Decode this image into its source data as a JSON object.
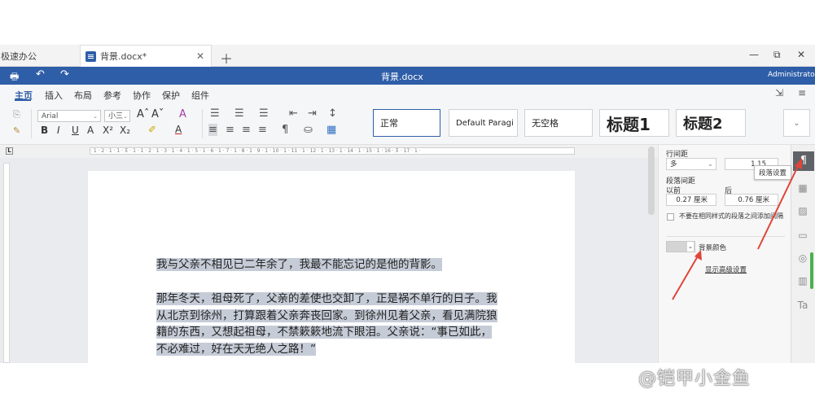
{
  "tabs": [
    {
      "label": "极速办公"
    },
    {
      "label": "背景.docx*"
    }
  ],
  "window": {
    "title": "背景.docx",
    "user": "Administrator"
  },
  "menu": [
    {
      "label": "主页"
    },
    {
      "label": "插入"
    },
    {
      "label": "布局"
    },
    {
      "label": "参考"
    },
    {
      "label": "协作"
    },
    {
      "label": "保护"
    },
    {
      "label": "组件"
    }
  ],
  "toolbar": {
    "font_name": "Arial",
    "font_size": "小三",
    "styles": [
      {
        "label": "正常"
      },
      {
        "label": "Default Paragi"
      },
      {
        "label": "无空格"
      },
      {
        "label": "标题1"
      },
      {
        "label": "标题2"
      }
    ]
  },
  "ruler": {
    "text": "· 1 · 2 · 1 · 1 · ⊼ · 1 · 1 · 2 · 1 · 3 · 1 · 4 · 1 · 5 · 1 · 6 · 1 · 7 · 1 · 8 · 1 · 9 · 1 · 10 · 1 · 11 · 1 · 12 · 1 · 13 · 1 · 14 · 1 · 15 · 1 · 16 · ⊼ · 17 · 1 ·"
  },
  "document": {
    "paragraphs": [
      {
        "lines": [
          "我与父亲不相见已二年余了，我最不能忘记的是他的背影。"
        ]
      },
      {
        "lines": [
          "那年冬天，祖母死了，父亲的差使也交卸了，正是祸不单行的日子。我",
          "从北京到徐州，打算跟着父亲奔丧回家。到徐州见着父亲，看见满院狼",
          "籍的东西，又想起祖母，不禁簌簌地流下眼泪。父亲说：“事已如此，",
          "不必难过，好在天无绝人之路！”"
        ]
      }
    ]
  },
  "panel": {
    "line_spacing_label": "行间距",
    "line_spacing_mode": "多",
    "line_spacing_value": "1.15",
    "para_spacing_label": "段落间距",
    "before_label": "以前",
    "after_label": "后",
    "before_value": "0.27 厘米",
    "after_value": "0.76 厘米",
    "no_space_label": "不要在相同样式的段落之间添加间隔",
    "bg_color_label": "背景颜色",
    "advanced_label": "显示高级设置",
    "tooltip": "段落设置"
  },
  "watermark": "@铠甲小金鱼",
  "colors": {
    "accent": "#2f5ea8",
    "selection": "#c6ccd7",
    "arrow": "#e0443a"
  }
}
